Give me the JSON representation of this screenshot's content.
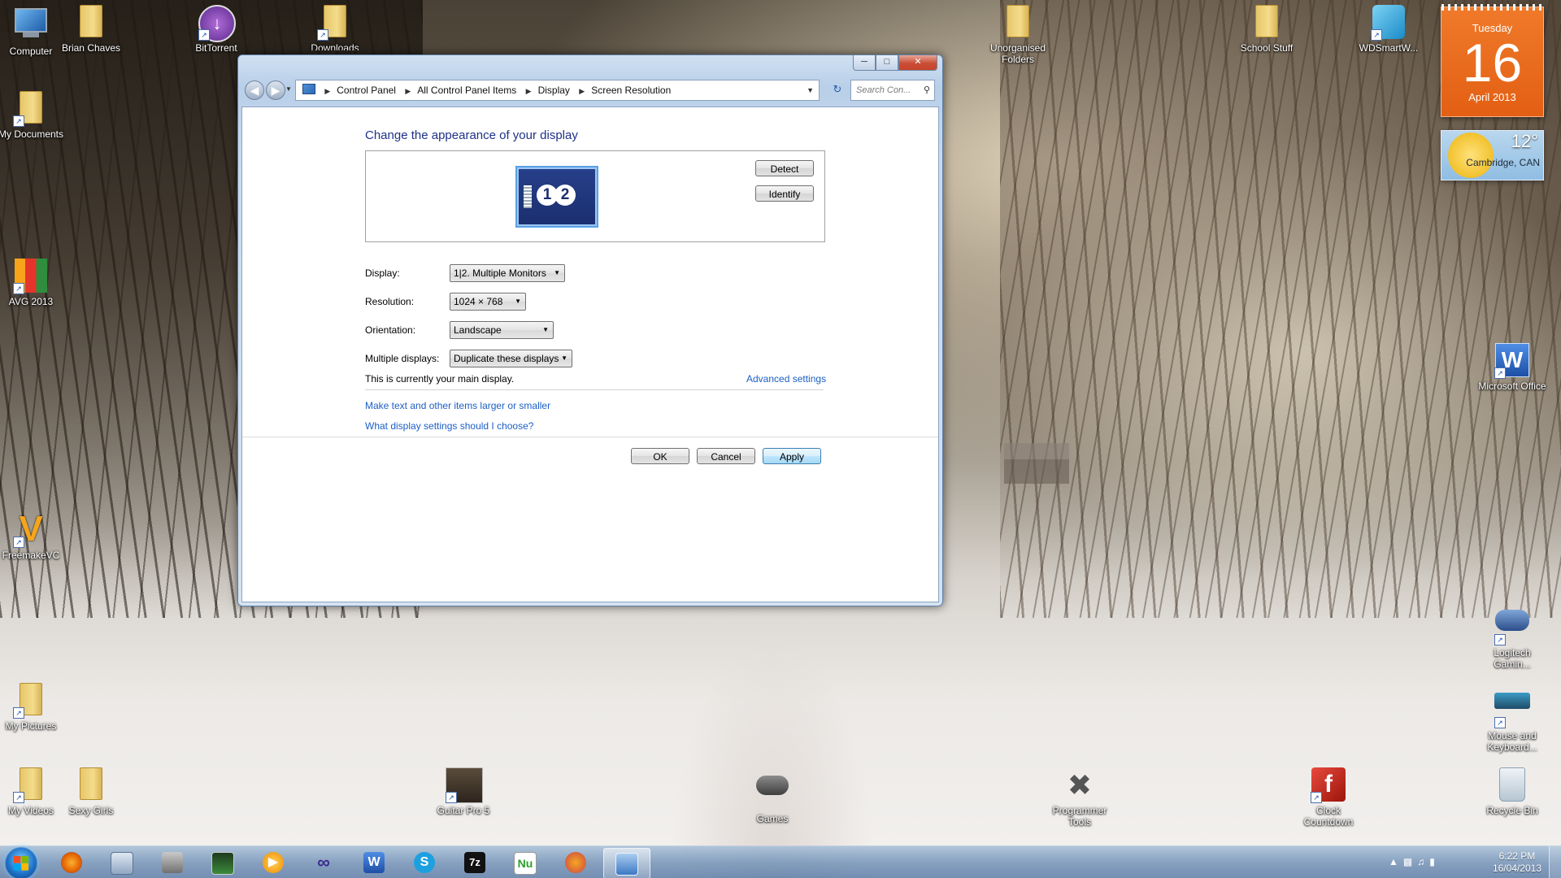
{
  "desktop": {
    "icons": [
      {
        "label": "Computer",
        "icon": "computer-icon"
      },
      {
        "label": "Brian Chaves",
        "icon": "user-folder-icon"
      },
      {
        "label": "BitTorrent",
        "icon": "bittorrent-icon"
      },
      {
        "label": "Downloads",
        "icon": "downloads-folder-icon"
      },
      {
        "label": "My Documents",
        "icon": "documents-folder-icon"
      },
      {
        "label": "AVG 2013",
        "icon": "avg-icon"
      },
      {
        "label": "FreemakeVC",
        "icon": "freemake-icon"
      },
      {
        "label": "My Pictures",
        "icon": "pictures-folder-icon"
      },
      {
        "label": "My Videos",
        "icon": "videos-folder-icon"
      },
      {
        "label": "Sexy Girls",
        "icon": "folder-icon"
      },
      {
        "label": "Guitar Pro 5",
        "icon": "guitar-pro-icon"
      },
      {
        "label": "Games",
        "icon": "games-controller-icon"
      },
      {
        "label": "Unorganised Folders",
        "icon": "folder-icon"
      },
      {
        "label": "School Stuff",
        "icon": "folder-icon"
      },
      {
        "label": "WDSmartW...",
        "icon": "wd-smartware-icon"
      },
      {
        "label": "Microsoft Office",
        "icon": "word-icon"
      },
      {
        "label": "Logitech Gamin...",
        "icon": "gamepad-icon"
      },
      {
        "label": "Mouse and Keyboard...",
        "icon": "keyboard-mouse-icon"
      },
      {
        "label": "Programmer Tools",
        "icon": "tools-icon"
      },
      {
        "label": "Clock Countdown",
        "icon": "flash-icon"
      },
      {
        "label": "Recycle Bin",
        "icon": "recycle-bin-icon"
      }
    ]
  },
  "gadgets": {
    "calendar": {
      "weekday": "Tuesday",
      "day": "16",
      "month_year": "April 2013"
    },
    "weather": {
      "temp": "12°",
      "city": "Cambridge, CAN"
    }
  },
  "window": {
    "title_buttons": {
      "minimize": "─",
      "maximize": "□",
      "close": "✕"
    },
    "breadcrumbs": [
      "Control Panel",
      "All Control Panel Items",
      "Display",
      "Screen Resolution"
    ],
    "search_placeholder": "Search Con...",
    "heading": "Change the appearance of your display",
    "monitor_numbers": [
      "1",
      "2"
    ],
    "detect_label": "Detect",
    "identify_label": "Identify",
    "fields": {
      "display": {
        "label": "Display:",
        "value": "1|2. Multiple Monitors"
      },
      "resolution": {
        "label": "Resolution:",
        "value": "1024 × 768"
      },
      "orientation": {
        "label": "Orientation:",
        "value": "Landscape"
      },
      "multiple_displays": {
        "label": "Multiple displays:",
        "value": "Duplicate these displays"
      }
    },
    "status_text": "This is currently your main display.",
    "advanced_link": "Advanced settings",
    "link_text_size": "Make text and other items larger or smaller",
    "link_which_settings": "What display settings should I choose?",
    "ok_label": "OK",
    "cancel_label": "Cancel",
    "apply_label": "Apply"
  },
  "taskbar": {
    "pinned": [
      {
        "name": "firefox",
        "icon": "firefox-icon"
      },
      {
        "name": "calculator",
        "icon": "calculator-icon"
      },
      {
        "name": "joystick",
        "icon": "joystick-icon"
      },
      {
        "name": "task-manager",
        "icon": "monitor-icon"
      },
      {
        "name": "media-player",
        "icon": "media-player-icon"
      },
      {
        "name": "infinity",
        "icon": "infinity-icon"
      },
      {
        "name": "word",
        "icon": "word-icon"
      },
      {
        "name": "skype",
        "icon": "skype-icon"
      },
      {
        "name": "7zip",
        "icon": "7zip-icon"
      },
      {
        "name": "nu",
        "icon": "nu-icon"
      },
      {
        "name": "eye-app",
        "icon": "eye-icon"
      },
      {
        "name": "display-settings",
        "icon": "display-settings-icon"
      }
    ],
    "clock": {
      "time": "6:22 PM",
      "date": "16/04/2013"
    }
  }
}
